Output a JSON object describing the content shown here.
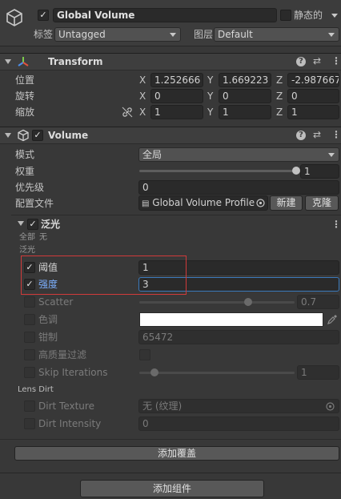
{
  "object": {
    "active": true,
    "name": "Global Volume",
    "static_label": "静态的",
    "static": false,
    "tag_label": "标签",
    "tag_value": "Untagged",
    "layer_label": "图层",
    "layer_value": "Default"
  },
  "transform": {
    "title": "Transform",
    "position_label": "位置",
    "rotation_label": "旋转",
    "scale_label": "缩放",
    "axis_x": "X",
    "axis_y": "Y",
    "axis_z": "Z",
    "position": {
      "x": "1.252666",
      "y": "1.669223",
      "z": "-2.987667"
    },
    "rotation": {
      "x": "0",
      "y": "0",
      "z": "0"
    },
    "scale": {
      "x": "1",
      "y": "1",
      "z": "1"
    }
  },
  "volume": {
    "title": "Volume",
    "enabled": true,
    "mode_label": "模式",
    "mode_value": "全局",
    "weight_label": "权重",
    "weight_value": "1",
    "weight_fraction": 1.0,
    "priority_label": "优先级",
    "priority_value": "0",
    "profile_label": "配置文件",
    "profile_value": "Global Volume Profile",
    "new_button": "新建",
    "clone_button": "克隆"
  },
  "bloom": {
    "title": "泛光",
    "enabled": true,
    "all_label": "全部",
    "none_label": "无",
    "section_label": "泛光",
    "threshold": {
      "label": "阈值",
      "value": "1",
      "override": true
    },
    "intensity": {
      "label": "强度",
      "value": "3",
      "override": true
    },
    "scatter": {
      "label": "Scatter",
      "value": "0.7",
      "fraction": 0.7,
      "override": false
    },
    "tint": {
      "label": "色调",
      "color": "#ffffff",
      "override": false
    },
    "clamp": {
      "label": "钳制",
      "value": "65472",
      "override": false
    },
    "high_quality": {
      "label": "高质量过滤",
      "override": false
    },
    "skip_iterations": {
      "label": "Skip Iterations",
      "value": "1",
      "fraction": 0.1,
      "override": false
    },
    "lens_dirt_label": "Lens Dirt",
    "dirt_texture": {
      "label": "Dirt Texture",
      "value": "无 (纹理)",
      "override": false
    },
    "dirt_intensity": {
      "label": "Dirt Intensity",
      "value": "0",
      "override": false
    }
  },
  "add_override_button": "添加覆盖",
  "add_component_button": "添加组件",
  "colors": {
    "background": "#383838",
    "highlight_box": "#d03a3a",
    "focus_border": "#3a79bb",
    "override_label": "#7cb0ff"
  },
  "icons": [
    "cube-icon",
    "transform-axes-icon",
    "volume-cube-icon",
    "help-icon",
    "presets-icon",
    "more-vert-icon",
    "link-icon",
    "target-icon",
    "eyedropper-icon"
  ]
}
